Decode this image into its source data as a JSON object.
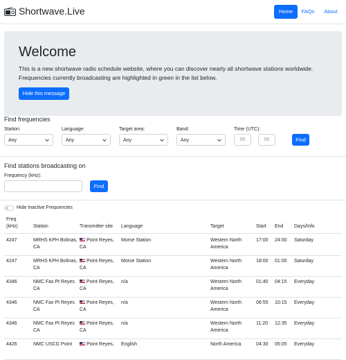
{
  "brand": {
    "name": "Shortwave.Live",
    "icon": "radio-icon"
  },
  "nav": {
    "home": "Home",
    "faqs": "FAQs",
    "about": "About"
  },
  "welcome": {
    "title": "Welcome",
    "text": "This is a new shortwave radio schedule website, where you can discover nearly all shortwave stations worldwide. Frequencies currently broadcasting are highlighted in green in the list below.",
    "hide_button": "Hide this message"
  },
  "find_frequencies": {
    "title": "Find frequencies",
    "station_label": "Station:",
    "station_value": "Any",
    "language_label": "Language:",
    "language_value": "Any",
    "target_label": "Target area:",
    "target_value": "Any",
    "band_label": "Band:",
    "band_value": "Any",
    "time_label": "Time (UTC):",
    "time_start_placeholder": "00",
    "time_end_placeholder": "00",
    "find_button": "Find"
  },
  "find_stations": {
    "title": "Find stations broadcasting on",
    "frequency_label": "Frequency (kHz):",
    "find_button": "Find"
  },
  "toggle": {
    "label": "Hide Inactive Frequencies"
  },
  "table": {
    "headers": {
      "freq": "Freq (kHz)",
      "station": "Station",
      "site": "Transmitter site",
      "language": "Language",
      "target": "Target",
      "start": "Start",
      "end": "End",
      "days": "Days/Info"
    },
    "rows": [
      {
        "freq": "4247",
        "station": "MRHS KPH Bolinas, CA",
        "site": "Point Reyes, CA",
        "language": "Morse Station",
        "target": "Western North America",
        "start": "17:00",
        "end": "24:00",
        "days": "Saturday"
      },
      {
        "freq": "4247",
        "station": "MRHS KPH Bolinas, CA",
        "site": "Point Reyes, CA",
        "language": "Morse Station",
        "target": "Western North America",
        "start": "18:00",
        "end": "01:00",
        "days": "Saturday"
      },
      {
        "freq": "4346",
        "station": "NMC Fax Pt Reyes CA",
        "site": "Point Reyes, CA",
        "language": "n/a",
        "target": "Western North America",
        "start": "01:40",
        "end": "04:15",
        "days": "Everyday"
      },
      {
        "freq": "4346",
        "station": "NMC Fax Pt Reyes CA",
        "site": "Point Reyes, CA",
        "language": "n/a",
        "target": "Western North America",
        "start": "06:55",
        "end": "10:15",
        "days": "Everyday"
      },
      {
        "freq": "4346",
        "station": "NMC Fax Pt Reyes CA",
        "site": "Point Reyes, CA",
        "language": "n/a",
        "target": "Western North America",
        "start": "11:20",
        "end": "12:35",
        "days": "Everyday"
      },
      {
        "freq": "4426",
        "station": "NMC USCG Point",
        "site": "Point Reyes,",
        "language": "English",
        "target": "North America",
        "start": "04:30",
        "end": "05:05",
        "days": "Everyday"
      }
    ]
  },
  "colors": {
    "primary": "#0d6efd",
    "hero_bg": "#e9ecef",
    "border": "#dee2e6"
  }
}
